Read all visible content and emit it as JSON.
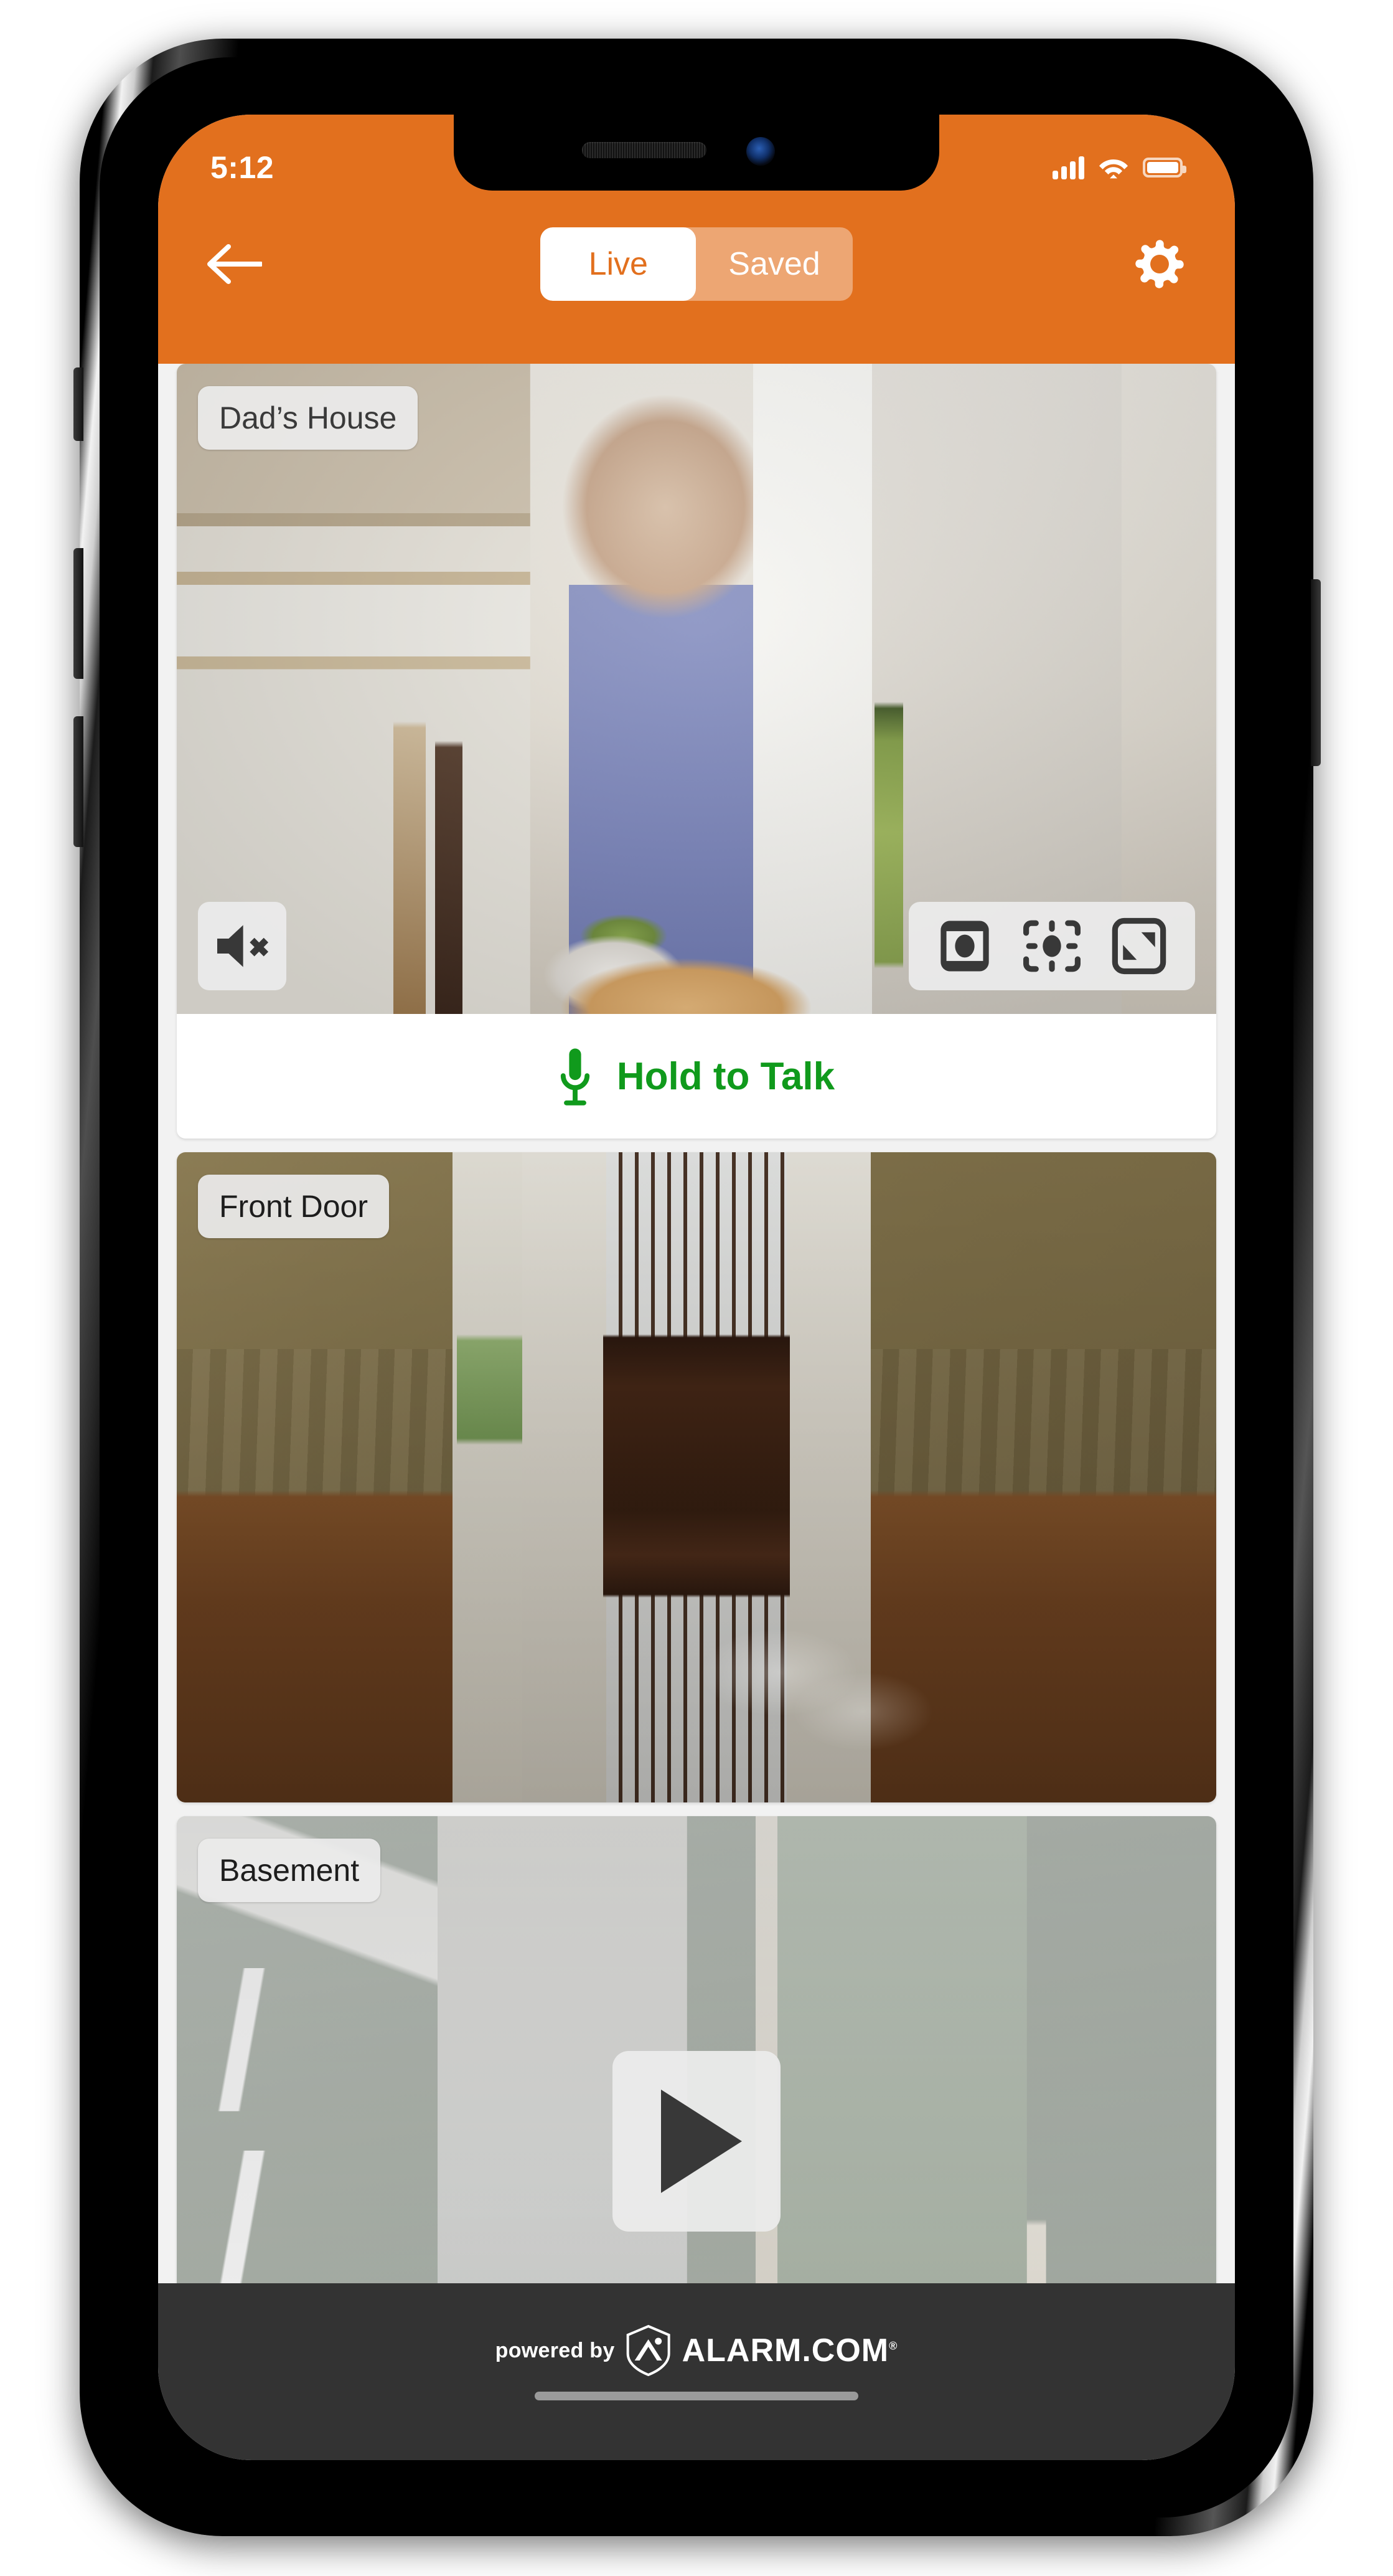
{
  "status_bar": {
    "time": "5:12",
    "signal_icon": "cellular-signal-icon",
    "wifi_icon": "wifi-icon",
    "battery_icon": "battery-full-icon"
  },
  "header": {
    "back_icon": "back-arrow-icon",
    "settings_icon": "gear-icon",
    "accent_color": "#E2701E",
    "tabs": [
      {
        "label": "Live",
        "active": true
      },
      {
        "label": "Saved",
        "active": false
      }
    ]
  },
  "cameras": [
    {
      "label": "Dad’s House",
      "state": "streaming",
      "mute_icon": "speaker-mute-icon",
      "controls": [
        {
          "icon": "snapshot-icon",
          "name": "snapshot-button"
        },
        {
          "icon": "focus-target-icon",
          "name": "focus-button"
        },
        {
          "icon": "fullscreen-expand-icon",
          "name": "fullscreen-button"
        }
      ],
      "talk": {
        "icon": "microphone-icon",
        "label": "Hold to Talk",
        "color": "#109A1C"
      }
    },
    {
      "label": "Front Door",
      "state": "streaming"
    },
    {
      "label": "Basement",
      "state": "paused",
      "play_icon": "play-icon"
    }
  ],
  "footer": {
    "powered_by": "powered by",
    "brand": "ALARM.COM",
    "registered_mark": "®",
    "shield_icon": "alarm-shield-logo-icon",
    "background_color": "#333333"
  }
}
